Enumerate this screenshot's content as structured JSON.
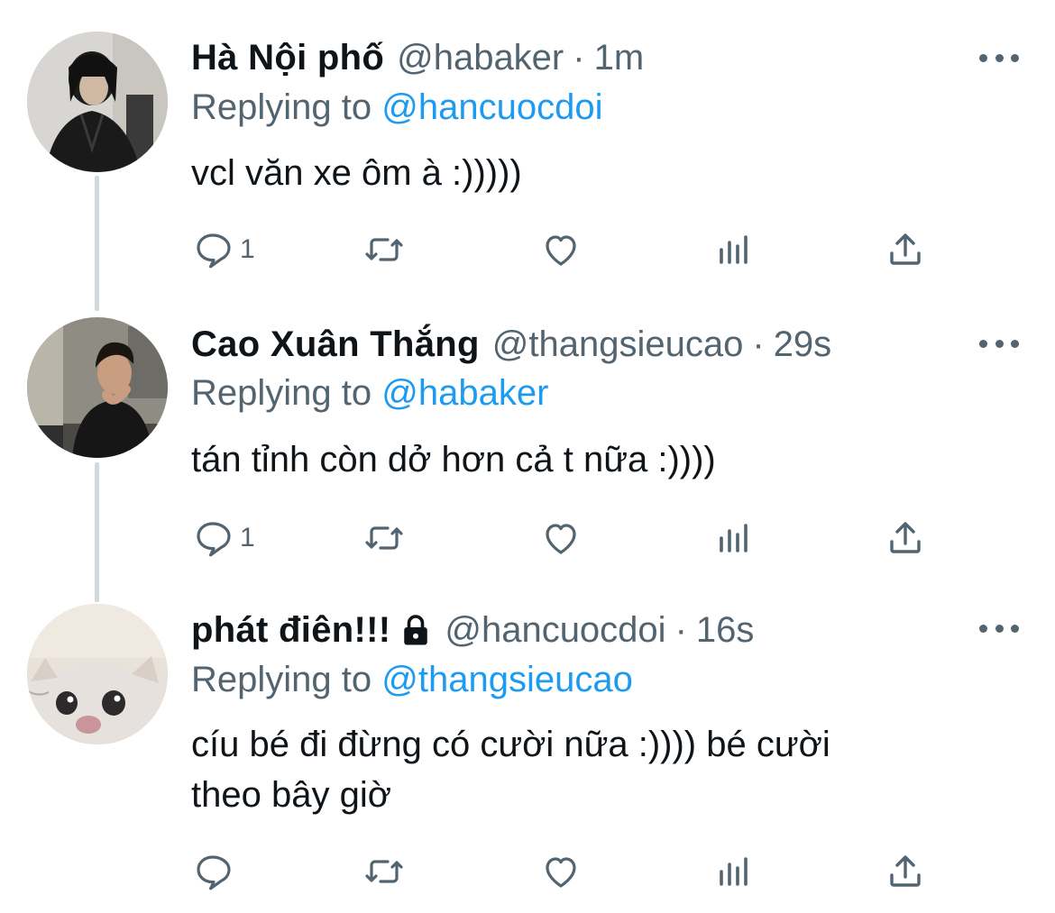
{
  "tweets": [
    {
      "name": "Hà Nội phố",
      "handle": "@habaker",
      "separator": "·",
      "time": "1m",
      "replying_prefix": "Replying to",
      "replying_to": "@hancuocdoi",
      "text_lines": [
        "vcl văn xe ôm à :)))))"
      ],
      "reply_count": "1",
      "avatar": "person-dark-jacket"
    },
    {
      "name": "Cao Xuân Thắng",
      "handle": "@thangsieucao",
      "separator": "·",
      "time": "29s",
      "replying_prefix": "Replying to",
      "replying_to": "@habaker",
      "text_lines": [
        "tán tỉnh còn dở hơn cả t nữa :))))"
      ],
      "reply_count": "1",
      "avatar": "person-thinking"
    },
    {
      "name": "phát điên!!!",
      "protected": true,
      "handle": "@hancuocdoi",
      "separator": "·",
      "time": "16s",
      "replying_prefix": "Replying to",
      "replying_to": "@thangsieucao",
      "text_lines": [
        "cíu bé đi đừng có cười nữa :)))) bé cười",
        "theo bây giờ"
      ],
      "reply_count": "",
      "avatar": "cat-peeking"
    }
  ],
  "icons": {
    "reply": "reply-icon",
    "retweet": "retweet-icon",
    "like": "like-icon",
    "analytics": "analytics-icon",
    "share": "share-icon",
    "more": "more-icon",
    "lock": "lock-icon"
  },
  "colors": {
    "link": "#1d9bf0",
    "muted": "#536471",
    "text": "#0f1419",
    "thread": "#cfd9de"
  }
}
